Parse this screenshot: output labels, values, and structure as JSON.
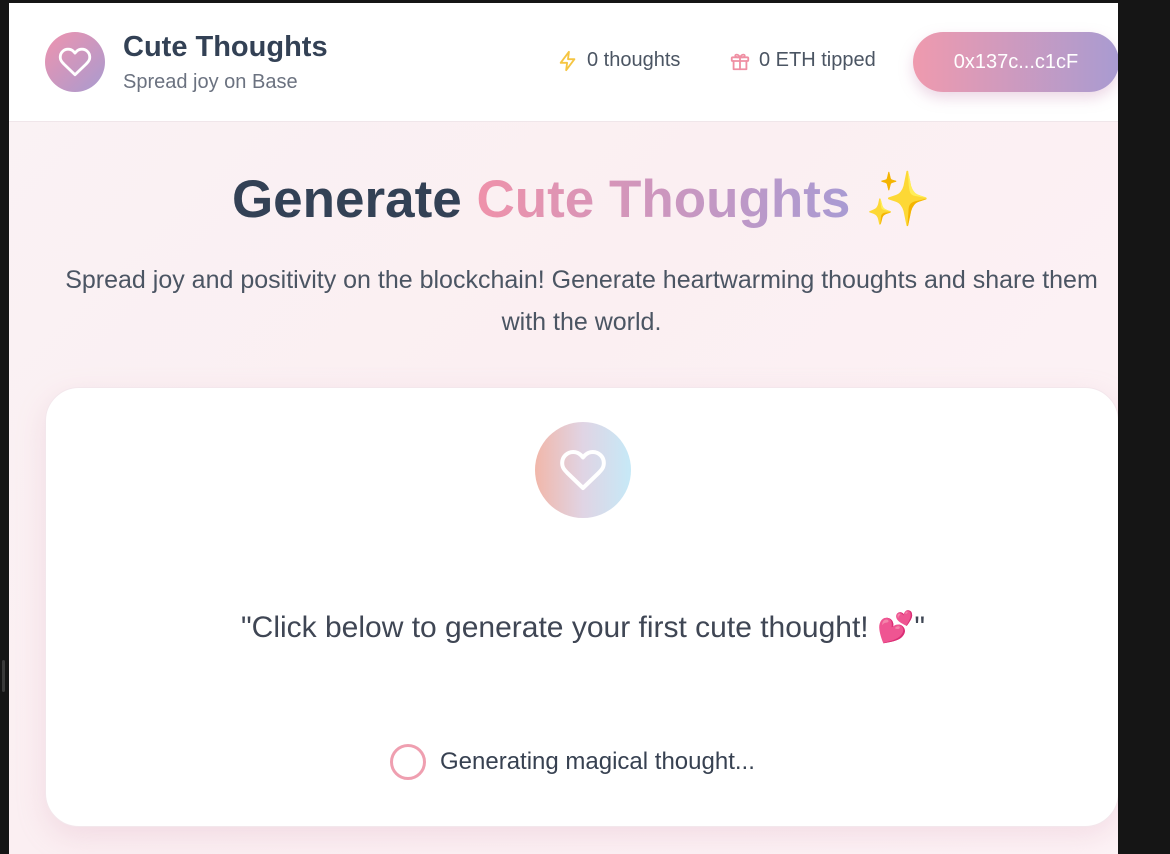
{
  "header": {
    "brand_title": "Cute Thoughts",
    "brand_subtitle": "Spread joy on Base",
    "logo_icon": "heart-icon",
    "stats": {
      "thoughts_label": "0 thoughts",
      "thoughts_icon": "lightning-icon",
      "tipped_label": "0 ETH tipped",
      "tipped_icon": "gift-icon"
    },
    "wallet_address": "0x137c...c1cF"
  },
  "hero": {
    "title_part1": "Generate",
    "title_accent": "Cute Thoughts",
    "title_emoji": "✨",
    "description": "Spread joy and positivity on the blockchain! Generate heartwarming thoughts and share them with the world."
  },
  "card": {
    "icon": "heart-icon",
    "thought_text": "\"Click below to generate your first cute thought! 💕\"",
    "loading_text": "Generating magical thought..."
  },
  "colors": {
    "primary_text": "#334155",
    "accent_pink": "#ef92aa",
    "accent_purple": "#a99bd3",
    "spinner": "#ef9fb0",
    "lightning": "#f5c542",
    "gift": "#ef8fa3"
  }
}
